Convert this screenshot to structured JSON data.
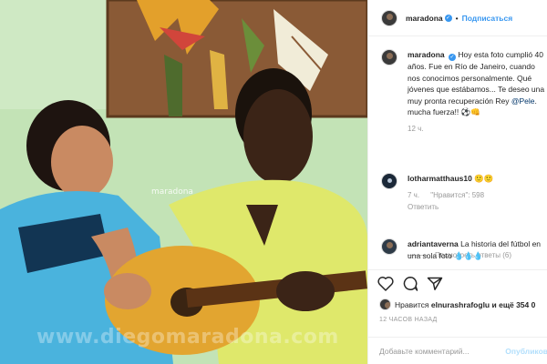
{
  "photo": {
    "tag_overlay": "maradona",
    "watermark": "www.diegomaradona.com"
  },
  "header": {
    "username": "maradona",
    "verified_glyph": "✓",
    "separator": "•",
    "follow_label": "Подписаться"
  },
  "caption": {
    "username": "maradona",
    "text": "Hoy esta foto cumplió 40 años. Fue en Río de Janeiro, cuando nos conocimos personalmente. Qué jóvenes que estábamos... Te deseo una muy pronta recuperación Rey ",
    "mention": "@Pele",
    "text_after": ". mucha fuerza!! ⚽👊",
    "time": "12 ч."
  },
  "comments": [
    {
      "username": "lotharmatthaus10",
      "text": "🙂🙂",
      "time": "7 ч.",
      "likes": "\"Нравится\": 598",
      "reply_label": "Ответить"
    },
    {
      "username": "adriantaverna",
      "text": "La historia del fútbol en una sola foto 💧💧💧"
    }
  ],
  "more_replies_label": "Посмотреть ответы (6)",
  "likes_line": {
    "prefix": "Нравится",
    "user": "elnurashrafoglu",
    "suffix": "и ещё 354 0"
  },
  "post_time": "12 ЧАСОВ НАЗАД",
  "comment_input": {
    "placeholder": "Добавьте комментарий...",
    "post_label": "Опубликов"
  },
  "icons": {
    "like": "heart-icon",
    "comment": "comment-icon",
    "share": "share-icon"
  },
  "colors": {
    "link_blue": "#3897f0",
    "mention_blue": "#003569",
    "muted_gray": "#999999",
    "post_disabled": "#b2dffc"
  }
}
